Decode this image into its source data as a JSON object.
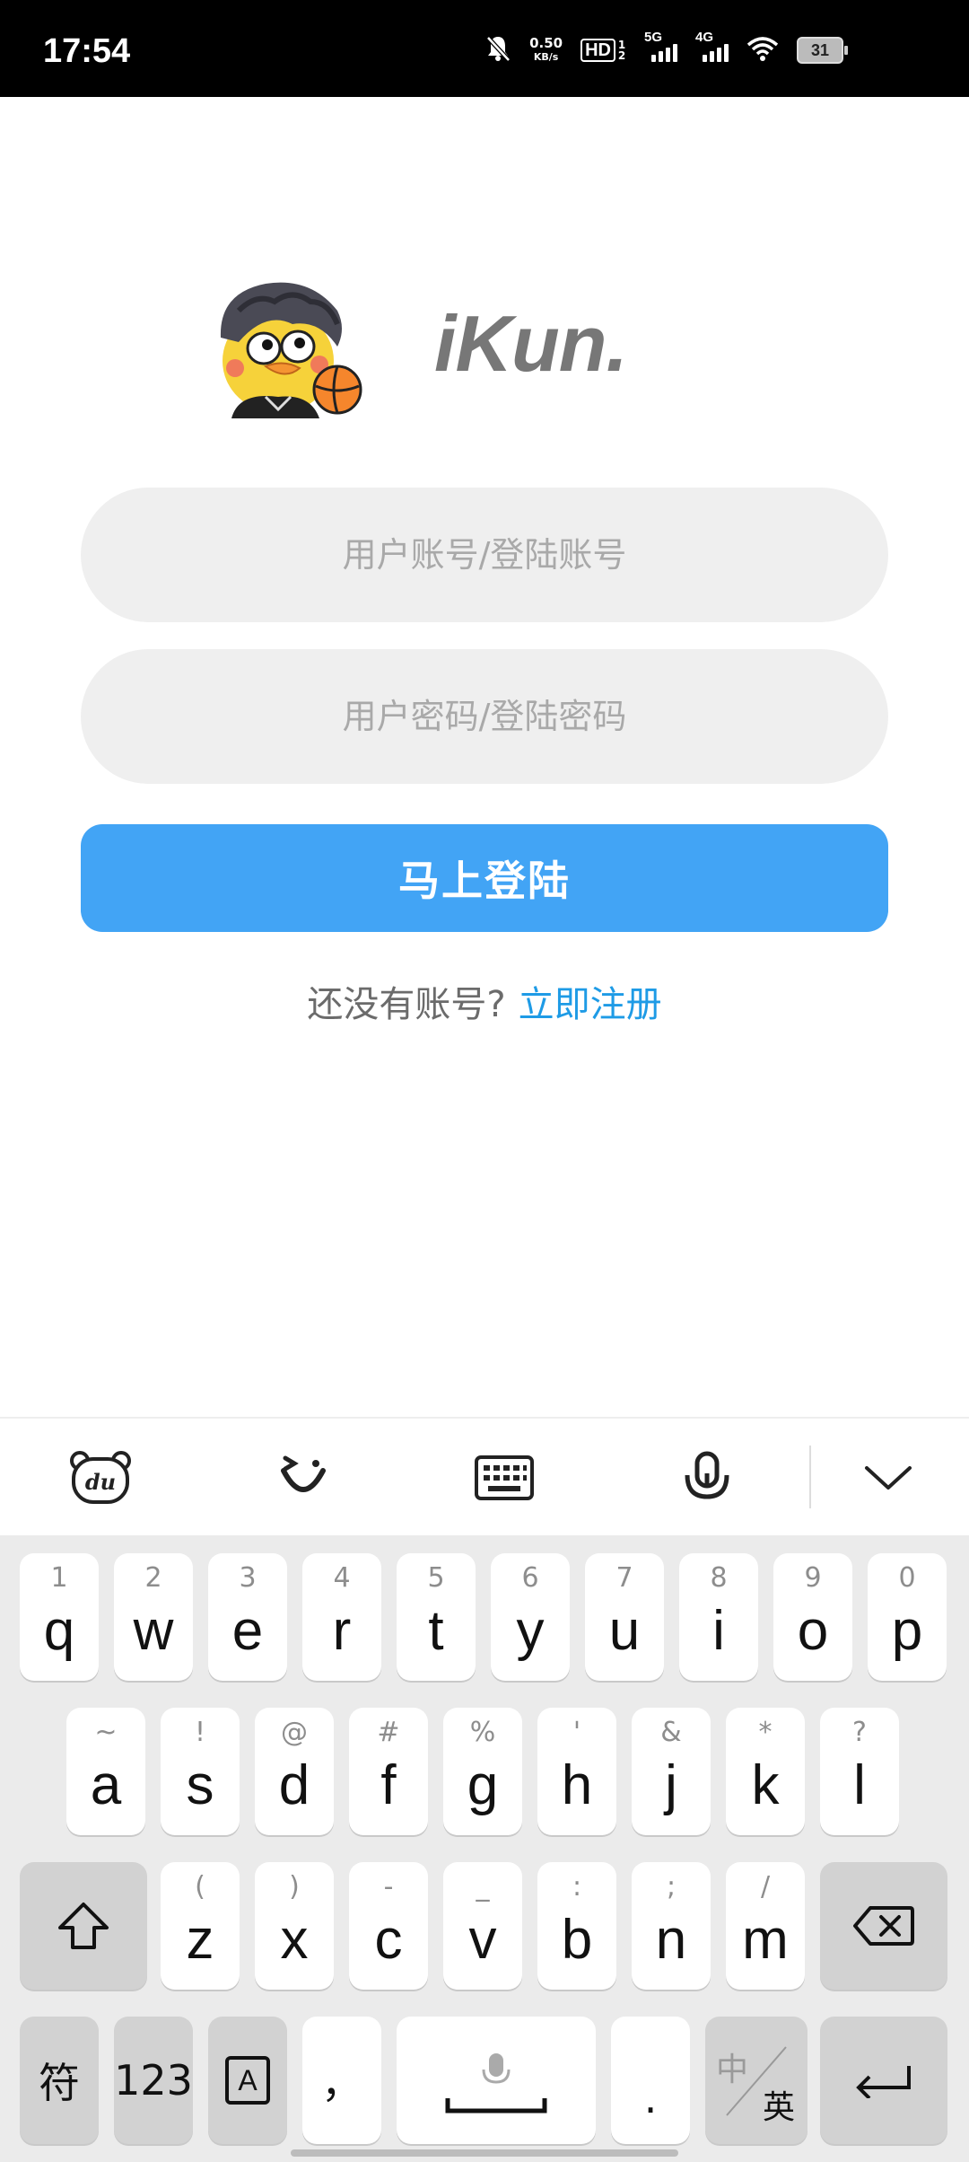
{
  "status_bar": {
    "time": "17:54",
    "net_speed_value": "0.50",
    "net_speed_unit": "KB/s",
    "hd_label": "HD",
    "hd_sub": "1 2",
    "sig1_label": "5G",
    "sig2_label": "4G",
    "battery": "31",
    "icons": [
      "mute-bell-icon",
      "hd-icon",
      "signal-5g-icon",
      "signal-4g-icon",
      "wifi-icon",
      "battery-icon"
    ]
  },
  "app": {
    "logo_text": "iKun."
  },
  "form": {
    "username_placeholder": "用户账号/登陆账号",
    "username_value": "",
    "password_placeholder": "用户密码/登陆密码",
    "password_value": "",
    "login_label": "马上登陆",
    "register_question": "还没有账号?",
    "register_link": "立即注册"
  },
  "colors": {
    "accent": "#42a4f5",
    "link": "#1e9be6",
    "field_bg": "#efefef"
  },
  "keyboard_toolbar": {
    "icons": [
      "baidu-input-icon",
      "emoji-icon",
      "keyboard-icon",
      "mic-icon",
      "collapse-chevron-icon"
    ],
    "du_label": "du"
  },
  "keyboard": {
    "row1": [
      {
        "main": "q",
        "sub": "1"
      },
      {
        "main": "w",
        "sub": "2"
      },
      {
        "main": "e",
        "sub": "3"
      },
      {
        "main": "r",
        "sub": "4"
      },
      {
        "main": "t",
        "sub": "5"
      },
      {
        "main": "y",
        "sub": "6"
      },
      {
        "main": "u",
        "sub": "7"
      },
      {
        "main": "i",
        "sub": "8"
      },
      {
        "main": "o",
        "sub": "9"
      },
      {
        "main": "p",
        "sub": "0"
      }
    ],
    "row2": [
      {
        "main": "a",
        "sub": "~"
      },
      {
        "main": "s",
        "sub": "!"
      },
      {
        "main": "d",
        "sub": "@"
      },
      {
        "main": "f",
        "sub": "#"
      },
      {
        "main": "g",
        "sub": "%"
      },
      {
        "main": "h",
        "sub": "'"
      },
      {
        "main": "j",
        "sub": "&"
      },
      {
        "main": "k",
        "sub": "*"
      },
      {
        "main": "l",
        "sub": "?"
      }
    ],
    "row3": [
      {
        "main": "z",
        "sub": "("
      },
      {
        "main": "x",
        "sub": ")"
      },
      {
        "main": "c",
        "sub": "-"
      },
      {
        "main": "v",
        "sub": "_"
      },
      {
        "main": "b",
        "sub": ":"
      },
      {
        "main": "n",
        "sub": ";"
      },
      {
        "main": "m",
        "sub": "/"
      }
    ],
    "symbols_label": "符",
    "numbers_label": "123",
    "a_label": "A",
    "comma_label": "，",
    "period_label": ".",
    "lang_cn": "中",
    "lang_en": "英"
  }
}
